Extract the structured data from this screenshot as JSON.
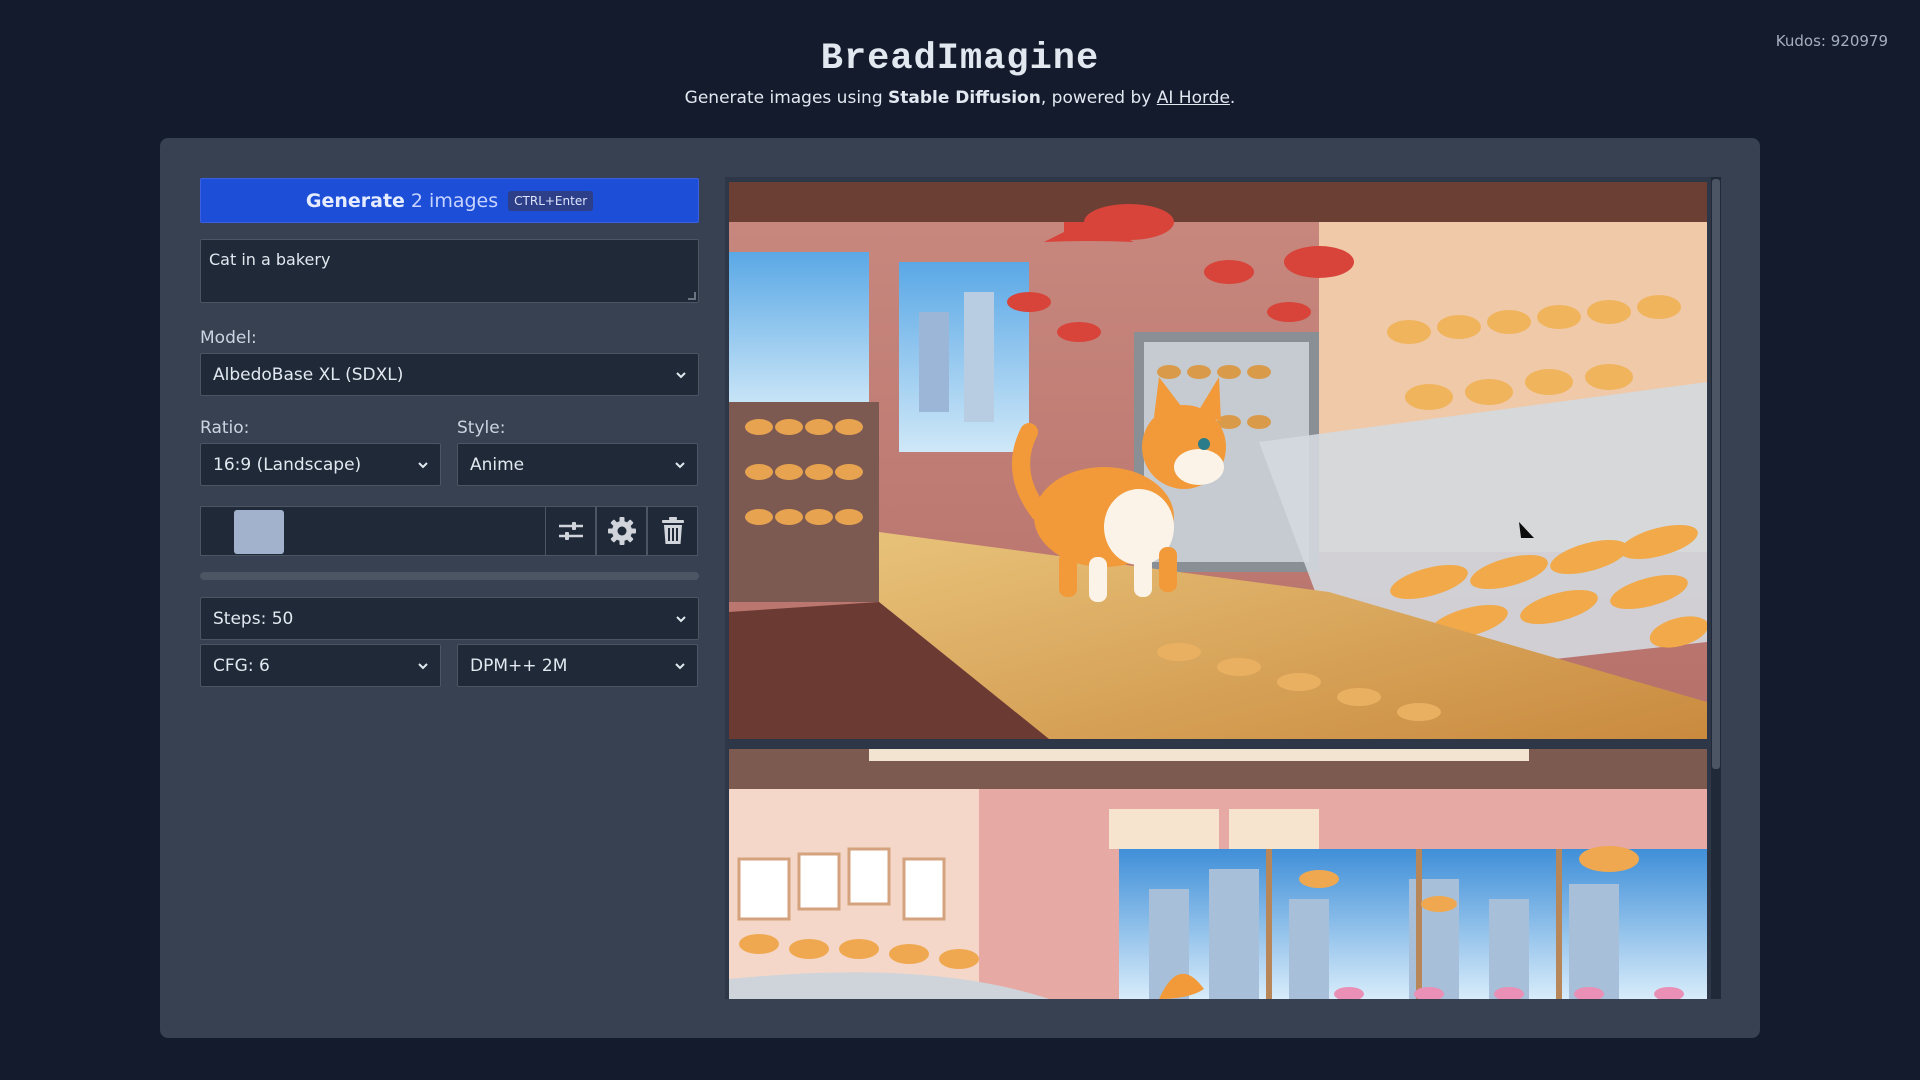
{
  "header": {
    "title": "BreadImagine",
    "subtitle_prefix": "Generate images using ",
    "subtitle_bold": "Stable Diffusion",
    "subtitle_mid": ", powered by ",
    "subtitle_link": "AI Horde",
    "subtitle_end": "."
  },
  "kudos": "Kudos: 920979",
  "generate": {
    "strong": "Generate",
    "count": "2 images",
    "shortcut": "CTRL+Enter"
  },
  "prompt": {
    "value": "Cat in a bakery"
  },
  "model": {
    "label": "Model:",
    "value": "AlbedoBase XL (SDXL)"
  },
  "ratio": {
    "label": "Ratio:",
    "value": "16:9 (Landscape)"
  },
  "style": {
    "label": "Style:",
    "value": "Anime"
  },
  "steps": {
    "value": "Steps: 50"
  },
  "cfg": {
    "value": "CFG: 6"
  },
  "sampler": {
    "value": "DPM++ 2M"
  },
  "colors": {
    "accent": "#1d4ed8",
    "panel": "#374151",
    "background": "#141b2d",
    "swatch": "#a3b2cc"
  },
  "icons": [
    "sliders-icon",
    "gear-icon",
    "trash-icon",
    "chevron-down-icon"
  ]
}
